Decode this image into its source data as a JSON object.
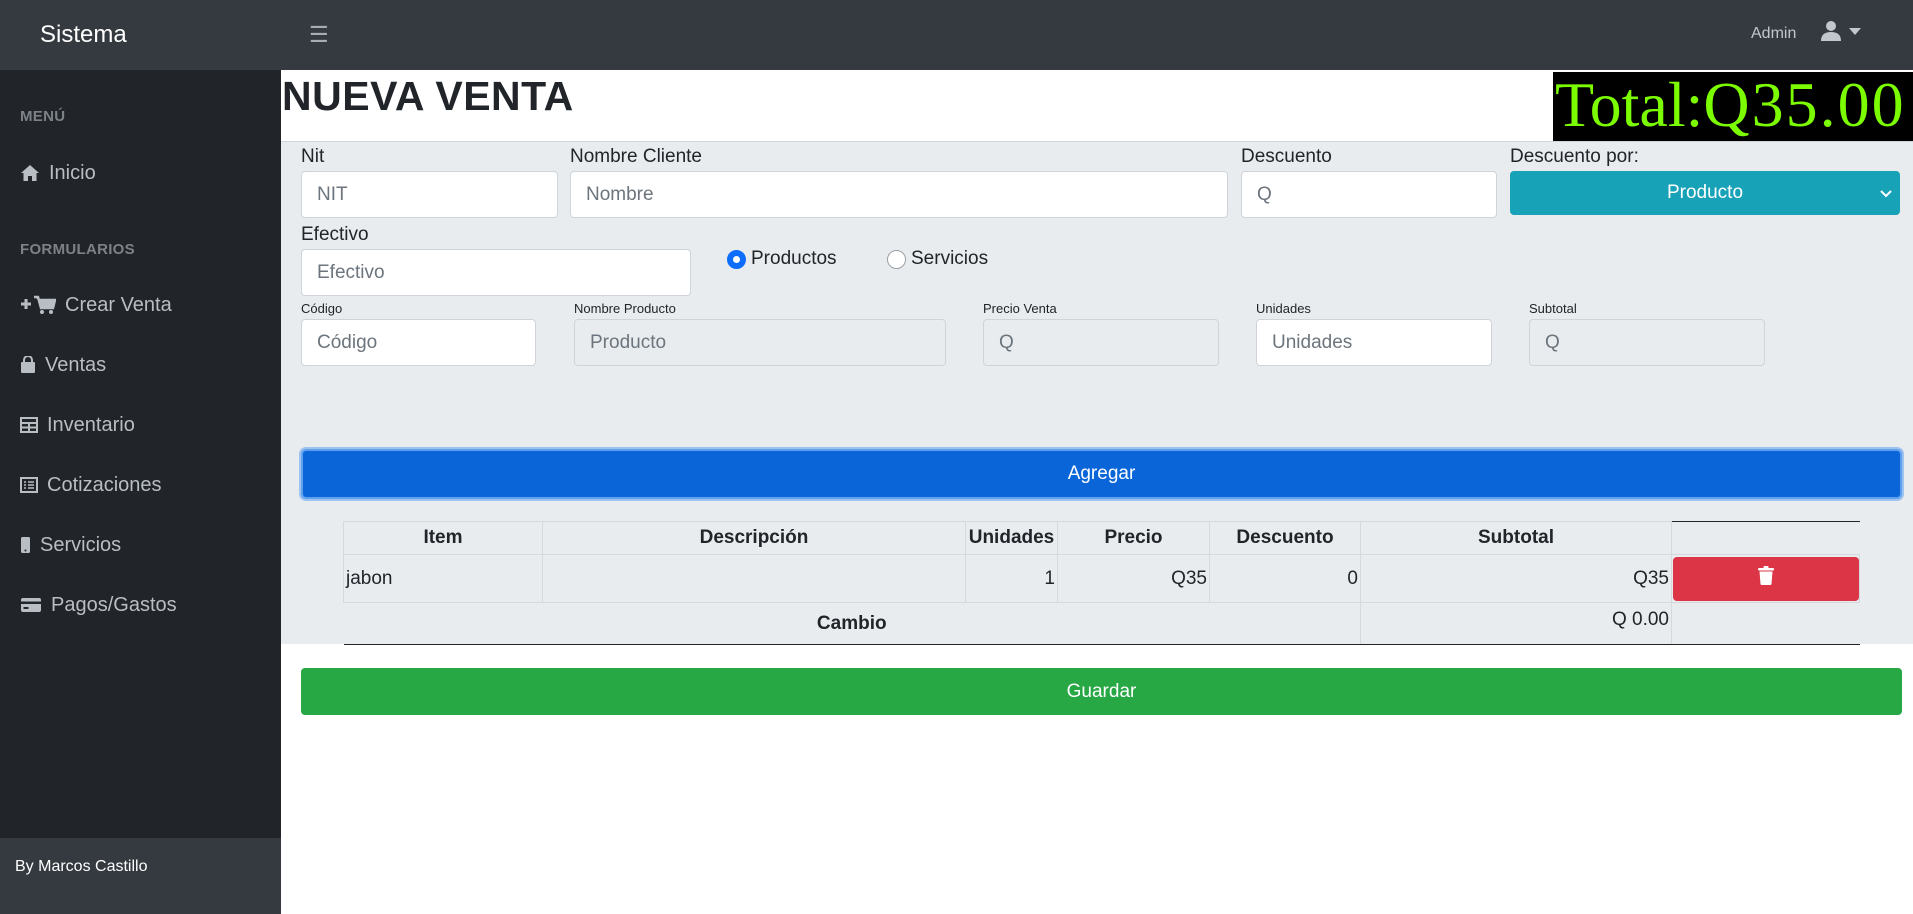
{
  "topbar": {
    "brand": "Sistema",
    "menu_icon": "☰",
    "user_name": "Admin",
    "user_icon": "user-icon"
  },
  "sidebar": {
    "heading_menu": "MENÚ",
    "heading_forms": "FORMULARIOS",
    "items": [
      {
        "label": "Inicio",
        "icon": "home-icon"
      },
      {
        "label": "Crear Venta",
        "icon": "add-to-cart-icon"
      },
      {
        "label": "Ventas",
        "icon": "shopping-bag-icon"
      },
      {
        "label": "Inventario",
        "icon": "table-icon"
      },
      {
        "label": "Cotizaciones",
        "icon": "list-alt-icon"
      },
      {
        "label": "Servicios",
        "icon": "mobile-icon"
      },
      {
        "label": "Pagos/Gastos",
        "icon": "credit-card-icon"
      }
    ],
    "footer": "By Marcos Castillo"
  },
  "page": {
    "title": "NUEVA VENTA",
    "total_label": "Total:Q",
    "total_value": "35.00"
  },
  "form": {
    "nit": {
      "label": "Nit",
      "placeholder": "NIT",
      "value": ""
    },
    "cliente": {
      "label": "Nombre Cliente",
      "placeholder": "Nombre",
      "value": ""
    },
    "descuento": {
      "label": "Descuento",
      "placeholder": "Q",
      "value": ""
    },
    "descuento_por": {
      "label": "Descuento por:",
      "selected": "Producto"
    },
    "efectivo": {
      "label": "Efectivo",
      "placeholder": "Efectivo",
      "value": ""
    },
    "tipo": {
      "options": [
        "Productos",
        "Servicios"
      ],
      "selected": "Productos"
    },
    "codigo": {
      "label": "Código",
      "placeholder": "Código",
      "value": ""
    },
    "nombre_producto": {
      "label": "Nombre Producto",
      "placeholder": "Producto",
      "value": ""
    },
    "precio_venta": {
      "label": "Precio Venta",
      "placeholder": "Q",
      "value": ""
    },
    "unidades": {
      "label": "Unidades",
      "placeholder": "Unidades",
      "value": ""
    },
    "subtotal": {
      "label": "Subtotal",
      "placeholder": "Q",
      "value": ""
    },
    "add_button": "Agregar",
    "save_button": "Guardar"
  },
  "table": {
    "columns": [
      "Item",
      "Descripción",
      "Unidades",
      "Precio",
      "Descuento",
      "Subtotal"
    ],
    "rows": [
      {
        "item": "jabon",
        "descripcion": "",
        "unidades": "1",
        "precio": "Q35",
        "descuento": "0",
        "subtotal": "Q35",
        "action_icon": "trash-icon"
      }
    ],
    "footer_label": "Cambio",
    "footer_value": "Q 0.00"
  },
  "colors": {
    "topbar": "#343a40",
    "sidebar": "#212529",
    "primary": "#0a66d8",
    "info": "#17a2b8",
    "success": "#28a745",
    "danger": "#dc3545",
    "total_text": "#7cfc00"
  }
}
